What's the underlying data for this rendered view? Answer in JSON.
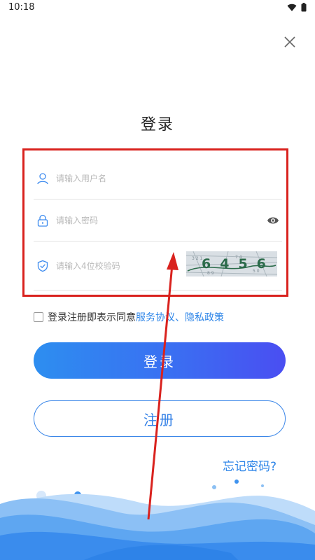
{
  "status_bar": {
    "time": "10:18"
  },
  "page": {
    "title": "登录"
  },
  "form": {
    "username_placeholder": "请输入用户名",
    "password_placeholder": "请输入密码",
    "captcha_placeholder": "请输入4位校验码",
    "captcha_text": "6456"
  },
  "agreement": {
    "prefix": "登录注册即表示同意",
    "service_link": "服务协议",
    "separator": "、",
    "privacy_link": "隐私政策"
  },
  "buttons": {
    "login": "登录",
    "register": "注册"
  },
  "forgot_password": "忘记密码?",
  "colors": {
    "accent": "#2f86e8",
    "highlight": "#d9221e",
    "icon": "#3d8bef"
  }
}
